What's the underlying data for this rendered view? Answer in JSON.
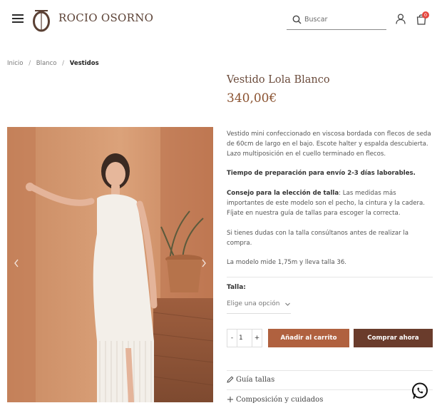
{
  "header": {
    "brand": "ROCIO OSORNO",
    "search_placeholder": "Buscar",
    "cart_count": "0"
  },
  "breadcrumb": {
    "items": [
      "Inicio",
      "Blanco"
    ],
    "current": "Vestidos",
    "separator": "/"
  },
  "product": {
    "title": "Vestido Lola Blanco",
    "price": "340,00€",
    "description": "Vestido mini confeccionado en viscosa bordada con flecos de seda de 60cm de largo en el bajo. Escote halter y espalda descubierta. Lazo multiposición en el cuello terminado en flecos.",
    "prep_time": "Tiempo de preparación para envío 2-3 días laborables.",
    "advice_label": "Consejo para la elección de talla",
    "advice_text": ": Las medidas más importantes de este modelo son el pecho, la cintura y la cadera. Fíjate en nuestra guía de tallas para escoger la correcta.",
    "doubts": "Si tienes dudas con la talla consúltanos antes de realizar la compra.",
    "model_info": "La modelo mide 1,75m y lleva talla 36."
  },
  "purchase": {
    "size_label": "Talla:",
    "size_placeholder": "Elige una opción",
    "qty_minus": "-",
    "qty_value": "1",
    "qty_plus": "+",
    "add_to_cart": "Añadir al carrito",
    "buy_now": "Comprar ahora"
  },
  "accordion": {
    "size_guide": "Guía tallas",
    "composition": "Composición y cuidados"
  },
  "colors": {
    "brand_brown": "#6a4a3a",
    "price": "#8a5230",
    "add_button": "#b0613f",
    "buy_button": "#6a3c2c",
    "badge": "#e5473f"
  },
  "icons": [
    "menu-icon",
    "brand-logo",
    "search-icon",
    "user-icon",
    "cart-icon",
    "chevron-left-icon",
    "chevron-right-icon",
    "chevron-down-icon",
    "pencil-icon",
    "plus-icon",
    "whatsapp-icon"
  ]
}
